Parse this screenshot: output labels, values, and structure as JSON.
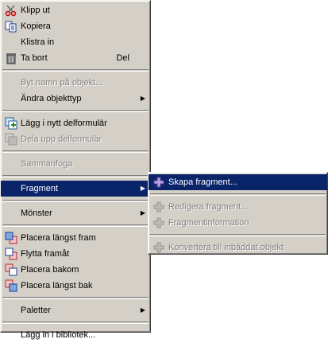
{
  "main_menu": {
    "cut": {
      "label": "Klipp ut",
      "icon": "scissors-icon"
    },
    "copy": {
      "label": "Kopiera",
      "icon": "copy-icon"
    },
    "paste": {
      "label": "Klistra in"
    },
    "delete": {
      "label": "Ta bort",
      "shortcut": "Del",
      "icon": "trash-icon"
    },
    "rename": {
      "label": "Byt namn på objekt..."
    },
    "change_type": {
      "label": "Ändra objekttyp"
    },
    "add_subform": {
      "label": "Lägg i nytt delformulär",
      "icon": "add-subform-icon"
    },
    "split_subform": {
      "label": "Dela upp delformulär",
      "icon": "split-subform-icon"
    },
    "merge": {
      "label": "Sammanfoga"
    },
    "fragment": {
      "label": "Fragment"
    },
    "pattern": {
      "label": "Mönster"
    },
    "bring_front": {
      "label": "Placera längst fram",
      "icon": "bring-to-front-icon"
    },
    "bring_forward": {
      "label": "Flytta framåt",
      "icon": "bring-forward-icon"
    },
    "send_back": {
      "label": "Placera bakom",
      "icon": "send-backward-icon"
    },
    "send_bottom": {
      "label": "Placera längst bak",
      "icon": "send-to-back-icon"
    },
    "palettes": {
      "label": "Paletter"
    },
    "add_library": {
      "label": "Lägg in i bibliotek..."
    }
  },
  "sub_menu": {
    "create_fragment": {
      "label": "Skapa fragment...",
      "icon": "fragment-icon"
    },
    "edit_fragment": {
      "label": "Redigera fragment...",
      "icon": "fragment-icon"
    },
    "fragment_info": {
      "label": "Fragmentinformation",
      "icon": "fragment-icon"
    },
    "convert_embedded": {
      "label": "Konvertera till inbäddat objekt",
      "icon": "fragment-icon"
    }
  },
  "colors": {
    "menu_bg": "#d4d0c8",
    "highlight": "#0a246a",
    "disabled_text": "#808080"
  }
}
